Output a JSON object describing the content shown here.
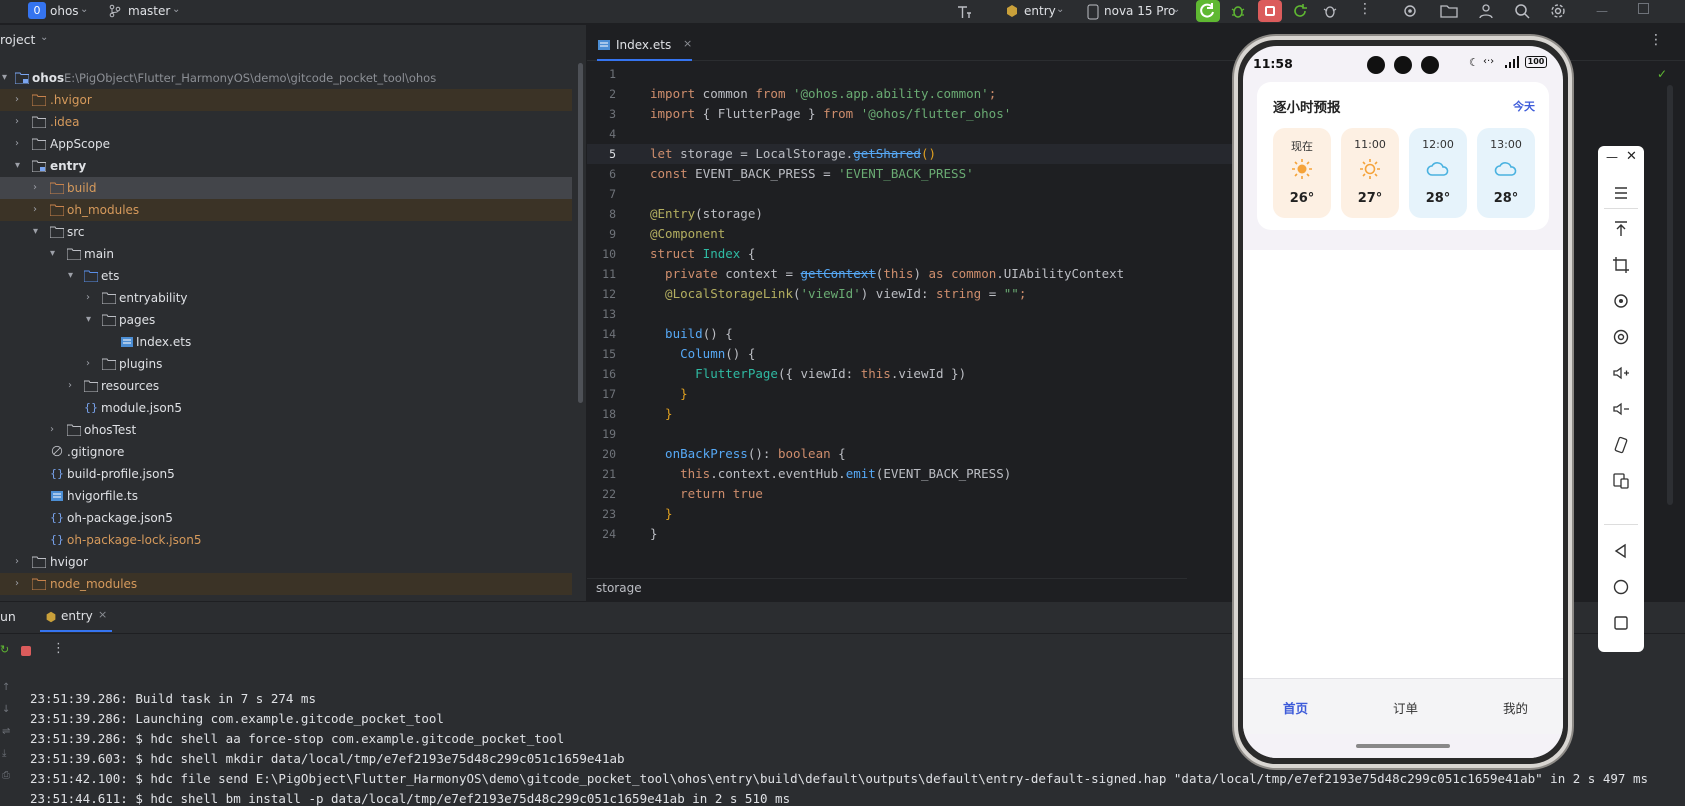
{
  "topbar": {
    "project_badge": "0",
    "project_name": "ohos",
    "branch": "master",
    "run_config": "entry",
    "device": "nova 15 Pro"
  },
  "project_panel": {
    "title": "roject",
    "root_label": "ohos",
    "root_path": "E:\\PigObject\\Flutter_HarmonyOS\\demo\\gitcode_pocket_tool\\ohos",
    "items": [
      {
        "label": ".hvigor",
        "icon": "folder-icon"
      },
      {
        "label": ".idea",
        "icon": "folder-icon"
      },
      {
        "label": "AppScope",
        "icon": "folder-icon"
      },
      {
        "label": "entry",
        "icon": "module-folder-icon"
      },
      {
        "label": "build",
        "icon": "folder-icon"
      },
      {
        "label": "oh_modules",
        "icon": "folder-icon"
      },
      {
        "label": "src",
        "icon": "folder-icon"
      },
      {
        "label": "main",
        "icon": "folder-icon"
      },
      {
        "label": "ets",
        "icon": "source-folder-icon"
      },
      {
        "label": "entryability",
        "icon": "folder-icon"
      },
      {
        "label": "pages",
        "icon": "folder-icon"
      },
      {
        "label": "Index.ets",
        "icon": "ets-file-icon"
      },
      {
        "label": "plugins",
        "icon": "folder-icon"
      },
      {
        "label": "resources",
        "icon": "folder-icon"
      },
      {
        "label": "module.json5",
        "icon": "json-file-icon"
      },
      {
        "label": "ohosTest",
        "icon": "folder-icon"
      },
      {
        "label": ".gitignore",
        "icon": "ignore-file-icon"
      },
      {
        "label": "build-profile.json5",
        "icon": "json-file-icon"
      },
      {
        "label": "hvigorfile.ts",
        "icon": "ts-file-icon"
      },
      {
        "label": "oh-package.json5",
        "icon": "json-file-icon"
      },
      {
        "label": "oh-package-lock.json5",
        "icon": "json-file-icon"
      },
      {
        "label": "hvigor",
        "icon": "folder-icon"
      },
      {
        "label": "node_modules",
        "icon": "folder-icon"
      }
    ]
  },
  "editor": {
    "tab_label": "Index.ets",
    "breadcrumb": "storage",
    "line_numbers": [
      "1",
      "2",
      "3",
      "4",
      "5",
      "6",
      "7",
      "8",
      "9",
      "10",
      "11",
      "12",
      "13",
      "14",
      "15",
      "16",
      "17",
      "18",
      "19",
      "20",
      "21",
      "22",
      "23",
      "24"
    ],
    "lines": {
      "l2": {
        "a": "import",
        "b": " common ",
        "c": "from",
        "d": " '@ohos.app.ability.common'",
        "e": ";"
      },
      "l3": {
        "a": "import",
        "b": " { FlutterPage } ",
        "c": "from",
        "d": " '@ohos/flutter_ohos'"
      },
      "l5": {
        "a": "let",
        "b": " storage = LocalStorage.",
        "c": "getShared",
        "d": "()"
      },
      "l6": {
        "a": "const",
        "b": " EVENT_BACK_PRESS = ",
        "c": "'EVENT_BACK_PRESS'"
      },
      "l8": {
        "a": "@Entry",
        "b": "(storage)"
      },
      "l9": {
        "a": "@Component"
      },
      "l10": {
        "a": "struct",
        "b": " Index",
        "c": " {"
      },
      "l11": {
        "a": "  private",
        "b": " context = ",
        "c": "getContext",
        "d": "(",
        "e": "this",
        "f": ") ",
        "g": "as",
        "h": " common",
        "i": ".UIAbilityContext"
      },
      "l12": {
        "a": "  @LocalStorageLink",
        "b": "(",
        "c": "'viewId'",
        "d": ") viewId: ",
        "e": "string",
        "f": " = ",
        "g": "\"\"",
        "h": ";"
      },
      "l14": {
        "a": "  build",
        "b": "() {"
      },
      "l15": {
        "a": "    Column",
        "b": "() {"
      },
      "l16": {
        "a": "      FlutterPage",
        "b": "({ viewId: ",
        "c": "this",
        "d": ".viewId })"
      },
      "l17": {
        "a": "    }"
      },
      "l18": {
        "a": "  }"
      },
      "l20": {
        "a": "  onBackPress",
        "b": "(): ",
        "c": "boolean",
        "d": " {"
      },
      "l21": {
        "a": "    this",
        "b": ".context.eventHub.",
        "c": "emit",
        "d": "(EVENT_BACK_PRESS)"
      },
      "l22": {
        "a": "    return",
        "b": " true"
      },
      "l23": {
        "a": "  }"
      },
      "l24": {
        "a": "}"
      }
    }
  },
  "run_panel": {
    "title": "un",
    "tab_label": "entry",
    "log_lines": [
      "23:51:39.286: Build task in 7 s 274 ms",
      "23:51:39.286: Launching com.example.gitcode_pocket_tool",
      "23:51:39.286: $ hdc shell aa force-stop com.example.gitcode_pocket_tool",
      "23:51:39.603: $ hdc shell mkdir data/local/tmp/e7ef2193e75d48c299c051c1659e41ab",
      "23:51:42.100: $ hdc file send E:\\PigObject\\Flutter_HarmonyOS\\demo\\gitcode_pocket_tool\\ohos\\entry\\build\\default\\outputs\\default\\entry-default-signed.hap \"data/local/tmp/e7ef2193e75d48c299c051c1659e41ab\" in 2 s 497 ms",
      "23:51:44.611: $ hdc shell bm install -p data/local/tmp/e7ef2193e75d48c299c051c1659e41ab in 2 s 510 ms"
    ]
  },
  "phone": {
    "time": "11:58",
    "battery": "100",
    "card_title": "逐小时预报",
    "card_link": "今天",
    "hours": [
      {
        "time": "现在",
        "temp": "26°",
        "icon": "sun-icon",
        "bg": "#fdf0e3"
      },
      {
        "time": "11:00",
        "temp": "27°",
        "icon": "sun-icon",
        "bg": "#fdf0e3"
      },
      {
        "time": "12:00",
        "temp": "28°",
        "icon": "cloud-icon",
        "bg": "#e6f3fb"
      },
      {
        "time": "13:00",
        "temp": "28°",
        "icon": "cloud-icon",
        "bg": "#e6f3fb"
      }
    ],
    "tabs": [
      "首页",
      "订单",
      "我的"
    ],
    "active_tab_color": "#3d5bd9"
  },
  "colors": {
    "accent": "#3574f0",
    "run_green": "#5fb832",
    "stop_red": "#db5c5c"
  }
}
